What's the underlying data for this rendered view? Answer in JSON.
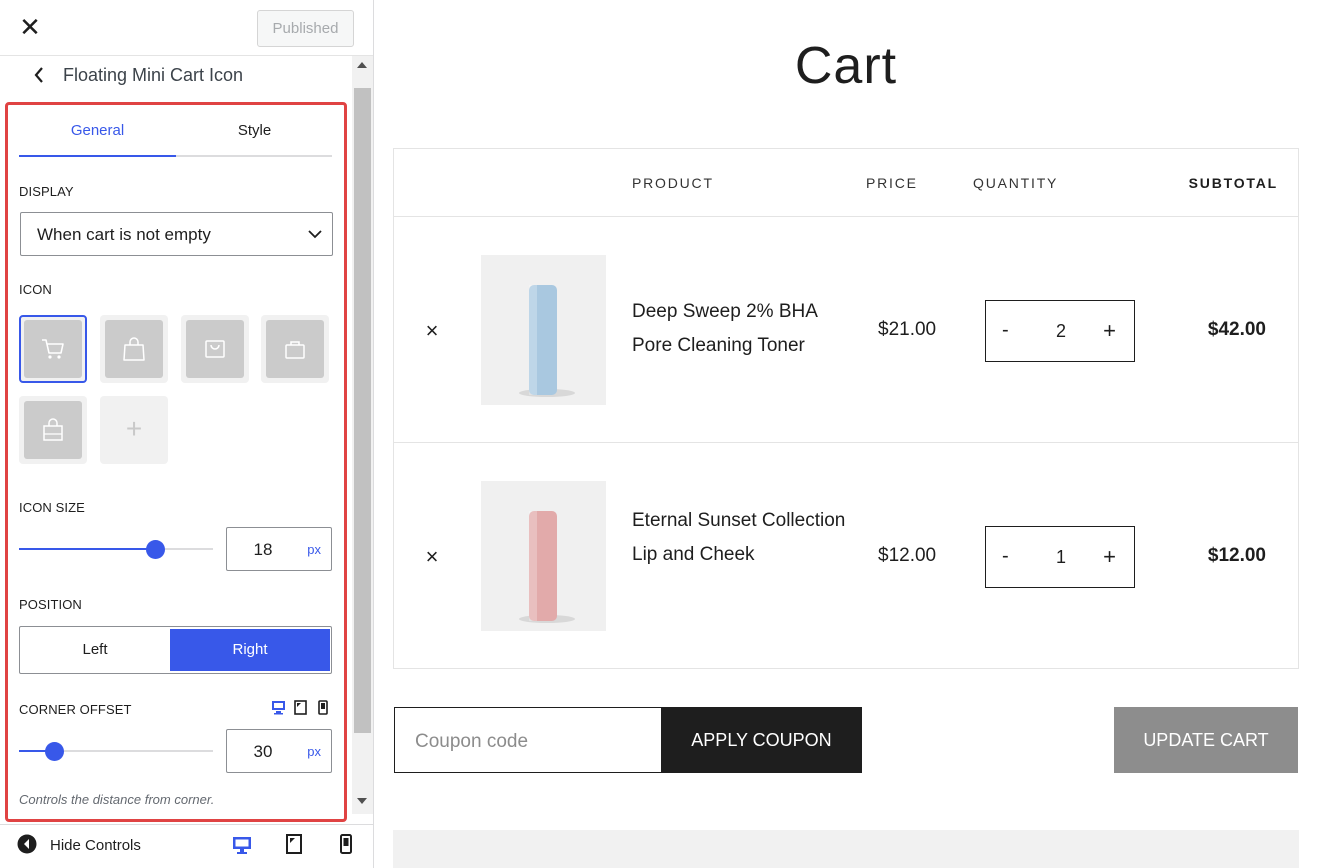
{
  "sidebar": {
    "publish_label": "Published",
    "panel_title": "Floating Mini Cart Icon",
    "tabs": [
      {
        "label": "General",
        "active": true
      },
      {
        "label": "Style",
        "active": false
      }
    ],
    "display": {
      "label": "DISPLAY",
      "value": "When cart is not empty"
    },
    "icon": {
      "label": "ICON",
      "options": [
        "cart-icon",
        "shopping-bag-icon",
        "basket-tray-icon",
        "briefcase-bag-icon",
        "tote-bag-icon"
      ],
      "selected": "cart-icon",
      "add_glyph": "+"
    },
    "icon_size": {
      "label": "ICON SIZE",
      "value": "18",
      "unit": "px",
      "slider_fraction": 0.7
    },
    "position": {
      "label": "POSITION",
      "left_label": "Left",
      "right_label": "Right",
      "selected": "Right"
    },
    "corner_offset": {
      "label": "CORNER OFFSET",
      "value": "30",
      "unit": "px",
      "slider_fraction": 0.18,
      "help": "Controls the distance from corner."
    },
    "footer": {
      "hide_label": "Hide Controls"
    },
    "accent_color": "#3858e9",
    "highlight_color": "#e04343"
  },
  "preview": {
    "title": "Cart",
    "columns": {
      "product": "PRODUCT",
      "price": "PRICE",
      "quantity": "QUANTITY",
      "subtotal": "SUBTOTAL"
    },
    "items": [
      {
        "name": "Deep Sweep 2% BHA Pore Cleaning Toner",
        "price": "$21.00",
        "quantity": "2",
        "subtotal": "$42.00",
        "bottle_color": "#a9c8e0"
      },
      {
        "name": "Eternal Sunset Collection Lip and Cheek",
        "price": "$12.00",
        "quantity": "1",
        "subtotal": "$12.00",
        "bottle_color": "#e2aaaa"
      }
    ],
    "remove_glyph": "×",
    "minus_glyph": "-",
    "plus_glyph": "+",
    "coupon_placeholder": "Coupon code",
    "apply_label": "APPLY COUPON",
    "update_label": "UPDATE CART"
  }
}
